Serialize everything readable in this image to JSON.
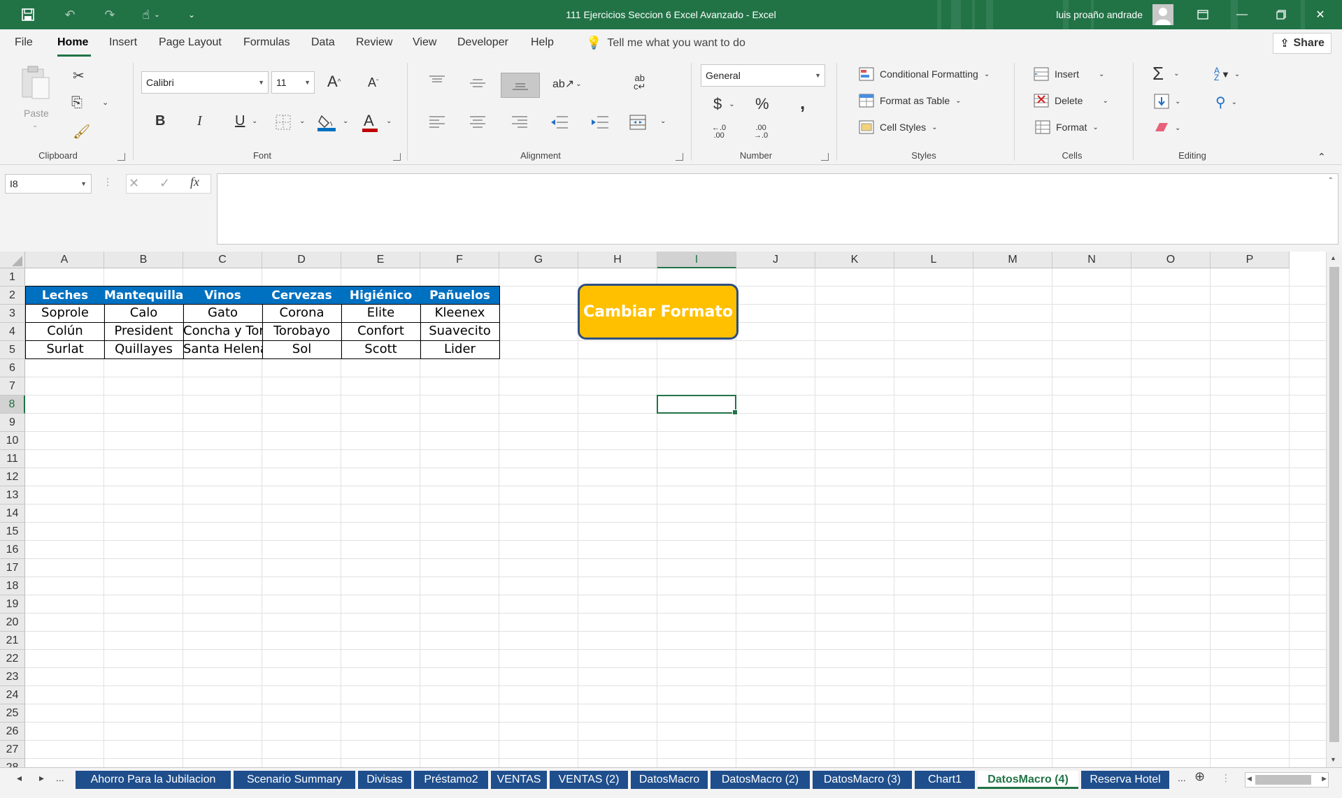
{
  "titlebar": {
    "title": "111 Ejercicios Seccion 6 Excel Avanzado  -  Excel",
    "user": "luis proaño andrade"
  },
  "menu": {
    "tabs": [
      "File",
      "Home",
      "Insert",
      "Page Layout",
      "Formulas",
      "Data",
      "Review",
      "View",
      "Developer",
      "Help"
    ],
    "active": "Home",
    "tell_me": "Tell me what you want to do",
    "share": "Share"
  },
  "ribbon": {
    "clipboard": {
      "label": "Clipboard",
      "paste": "Paste"
    },
    "font": {
      "label": "Font",
      "name": "Calibri",
      "size": "11",
      "bold": "B",
      "italic": "I",
      "underline": "U"
    },
    "alignment": {
      "label": "Alignment"
    },
    "number": {
      "label": "Number",
      "format": "General",
      "currency": "$",
      "percent": "%",
      "comma": ","
    },
    "styles": {
      "label": "Styles",
      "conditional": "Conditional Formatting",
      "table": "Format as Table",
      "cell": "Cell Styles"
    },
    "cells": {
      "label": "Cells",
      "insert": "Insert",
      "delete": "Delete",
      "format": "Format"
    },
    "editing": {
      "label": "Editing"
    }
  },
  "formula_bar": {
    "name_box": "I8",
    "fx": "fx",
    "value": ""
  },
  "grid": {
    "columns": [
      "A",
      "B",
      "C",
      "D",
      "E",
      "F",
      "G",
      "H",
      "I",
      "J",
      "K",
      "L",
      "M",
      "N",
      "O",
      "P"
    ],
    "selected_column": "I",
    "rows": [
      "1",
      "2",
      "3",
      "4",
      "5",
      "6",
      "7",
      "8",
      "9",
      "10",
      "11",
      "12",
      "13",
      "14",
      "15",
      "16",
      "17",
      "18",
      "19",
      "20",
      "21",
      "22",
      "23",
      "24",
      "25",
      "26",
      "27",
      "28"
    ],
    "selected_row": "8",
    "table": {
      "headers": [
        "Leches",
        "Mantequillas",
        "Vinos",
        "Cervezas",
        "Higiénico",
        "Pañuelos"
      ],
      "rows": [
        [
          "Soprole",
          "Calo",
          "Gato",
          "Corona",
          "Elite",
          "Kleenex"
        ],
        [
          "Colún",
          "President",
          "Concha y Toro",
          "Torobayo",
          "Confort",
          "Suavecito"
        ],
        [
          "Surlat",
          "Quillayes",
          "Santa Helena",
          "Sol",
          "Scott",
          "Lider"
        ]
      ],
      "header_color": "#0070c0"
    },
    "macro_button": "Cambiar Formato"
  },
  "sheets": {
    "tabs": [
      "Ahorro Para la Jubilacion",
      "Scenario Summary",
      "Divisas",
      "Préstamo2",
      "VENTAS",
      "VENTAS (2)",
      "DatosMacro",
      "DatosMacro (2)",
      "DatosMacro (3)",
      "Chart1",
      "DatosMacro (4)",
      "Reserva Hotel"
    ],
    "active": "DatosMacro (4)",
    "more": "..."
  },
  "colors": {
    "accent": "#217346",
    "tab_blue": "#1f4e8c",
    "button_fill": "#ffc000"
  }
}
